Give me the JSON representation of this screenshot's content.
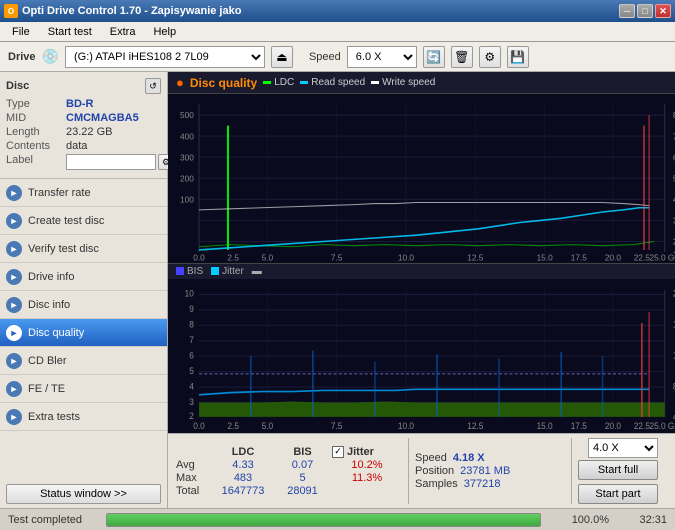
{
  "titleBar": {
    "title": "Opti Drive Control 1.70 - Zapisywanie jako",
    "icon": "O",
    "buttons": [
      "minimize",
      "maximize",
      "close"
    ]
  },
  "menu": {
    "items": [
      "File",
      "Start test",
      "Extra",
      "Help"
    ]
  },
  "drive": {
    "label": "Drive",
    "selected": "(G:) ATAPI iHES108 2 7L09",
    "speedLabel": "Speed",
    "speedSelected": "6.0 X"
  },
  "disc": {
    "title": "Disc",
    "type_label": "Type",
    "type_val": "BD-R",
    "mid_label": "MID",
    "mid_val": "CMCMAGBA5",
    "length_label": "Length",
    "length_val": "23.22 GB",
    "contents_label": "Contents",
    "contents_val": "data",
    "label_label": "Label",
    "label_val": ""
  },
  "nav": {
    "items": [
      {
        "id": "transfer-rate",
        "label": "Transfer rate",
        "active": false
      },
      {
        "id": "create-test-disc",
        "label": "Create test disc",
        "active": false
      },
      {
        "id": "verify-test-disc",
        "label": "Verify test disc",
        "active": false
      },
      {
        "id": "drive-info",
        "label": "Drive info",
        "active": false
      },
      {
        "id": "disc-info",
        "label": "Disc info",
        "active": false
      },
      {
        "id": "disc-quality",
        "label": "Disc quality",
        "active": true
      },
      {
        "id": "cd-bler",
        "label": "CD Bler",
        "active": false
      },
      {
        "id": "fe-te",
        "label": "FE / TE",
        "active": false
      },
      {
        "id": "extra-tests",
        "label": "Extra tests",
        "active": false
      }
    ],
    "statusWindow": "Status window >>"
  },
  "quality": {
    "title": "Disc quality",
    "legend": {
      "ldc": "LDC",
      "read": "Read speed",
      "write": "Write speed"
    },
    "bisLegend": {
      "bis": "BIS",
      "jitter": "Jitter"
    }
  },
  "stats": {
    "headers": [
      "LDC",
      "BIS",
      "",
      "Jitter",
      "Speed",
      "",
      ""
    ],
    "avg_label": "Avg",
    "avg_ldc": "4.33",
    "avg_bis": "0.07",
    "avg_jitter": "10.2%",
    "avg_speed": "4.18 X",
    "max_label": "Max",
    "max_ldc": "483",
    "max_bis": "5",
    "max_jitter": "11.3%",
    "total_label": "Total",
    "total_ldc": "1647773",
    "total_bis": "28091",
    "position_label": "Position",
    "position_val": "23781 MB",
    "samples_label": "Samples",
    "samples_val": "377218",
    "speed_dropdown": "4.0 X",
    "btn_full": "Start full",
    "btn_part": "Start part"
  },
  "progress": {
    "status_label": "Test completed",
    "percent": "100.0%",
    "time": "32:31",
    "fill_width": 100
  }
}
